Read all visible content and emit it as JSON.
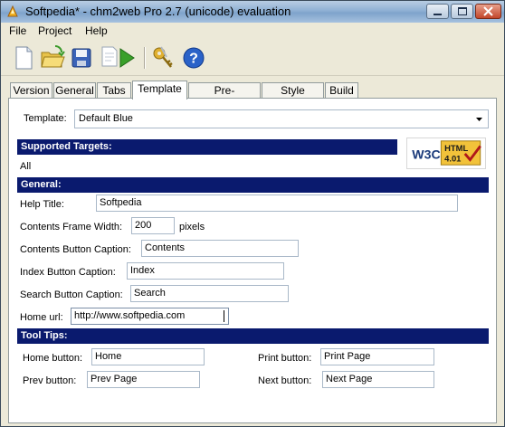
{
  "window": {
    "title": "Softpedia* - chm2web Pro 2.7 (unicode) evaluation"
  },
  "menu": [
    {
      "label": "File"
    },
    {
      "label": "Project"
    },
    {
      "label": "Help"
    }
  ],
  "toolbar": {
    "buttons": [
      "new-document-icon",
      "open-folder-icon",
      "save-icon",
      "run-icon",
      "keys-icon",
      "help-icon"
    ]
  },
  "tabs": [
    {
      "label": "Version"
    },
    {
      "label": "General"
    },
    {
      "label": "Tabs"
    },
    {
      "label": "Template",
      "active": true
    },
    {
      "label": "Pre-processing"
    },
    {
      "label": "Style Sheets"
    },
    {
      "label": "Build"
    }
  ],
  "template": {
    "label": "Template:",
    "value": "Default Blue"
  },
  "supported_targets": {
    "header": "Supported Targets:",
    "value": "All",
    "badge_left": "W3C",
    "badge_top": "HTML",
    "badge_bottom": "4.01"
  },
  "general": {
    "header": "General:",
    "help_title_label": "Help Title:",
    "help_title_value": "Softpedia",
    "contents_frame_width_label": "Contents Frame Width:",
    "contents_frame_width_value": "200",
    "contents_frame_width_unit": "pixels",
    "contents_button_caption_label": "Contents Button Caption:",
    "contents_button_caption_value": "Contents",
    "index_button_caption_label": "Index Button Caption:",
    "index_button_caption_value": "Index",
    "search_button_caption_label": "Search Button Caption:",
    "search_button_caption_value": "Search",
    "home_url_label": "Home url:",
    "home_url_value": "http://www.softpedia.com"
  },
  "tool_tips": {
    "header": "Tool Tips:",
    "home_button_label": "Home button:",
    "home_button_value": "Home",
    "prev_button_label": "Prev button:",
    "prev_button_value": "Prev Page",
    "print_button_label": "Print button:",
    "print_button_value": "Print Page",
    "next_button_label": "Next button:",
    "next_button_value": "Next Page"
  },
  "colors": {
    "section_header_bg": "#0a1a6e",
    "window_bg": "#ece9d8"
  }
}
